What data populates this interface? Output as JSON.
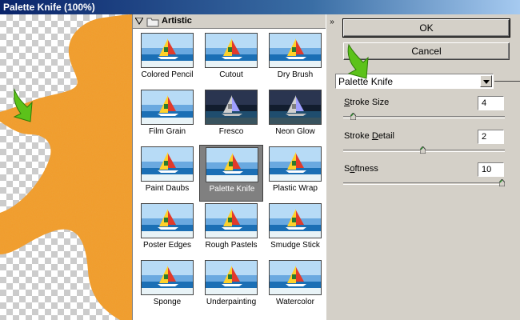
{
  "window": {
    "title": "Palette Knife (100%)"
  },
  "gallery": {
    "category": "Artistic",
    "filters": [
      "Colored Pencil",
      "Cutout",
      "Dry Brush",
      "Film Grain",
      "Fresco",
      "Neon Glow",
      "Paint Daubs",
      "Palette Knife",
      "Plastic Wrap",
      "Poster Edges",
      "Rough Pastels",
      "Smudge Stick",
      "Sponge",
      "Underpainting",
      "Watercolor"
    ],
    "selected": "Palette Knife"
  },
  "controls": {
    "collapse_glyph": "»",
    "ok_label": "OK",
    "cancel_label": "Cancel",
    "filter_select_value": "Palette Knife",
    "params": [
      {
        "label": "Stroke Size",
        "accel": "S",
        "value": "4",
        "fraction": 0.06
      },
      {
        "label": "Stroke Detail",
        "accel": "D",
        "value": "2",
        "fraction": 0.5
      },
      {
        "label": "Softness",
        "accel": "o",
        "value": "10",
        "fraction": 1.0
      }
    ]
  },
  "colors": {
    "preview_fill": "#f29a2e",
    "accent_green": "#5cc21a",
    "selected_cell": "#808080"
  },
  "icons": {
    "collapse": "double-chevron-icon",
    "folder": "folder-icon",
    "expand": "triangle-down-icon",
    "pointer": "green-arrow-icon"
  }
}
